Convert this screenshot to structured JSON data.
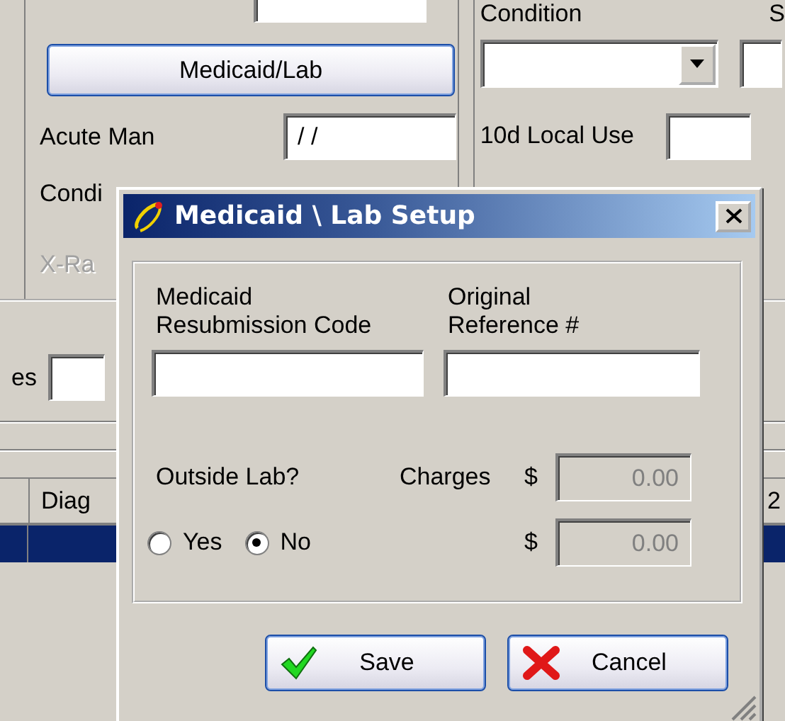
{
  "background_form": {
    "left_panel": {
      "medicaid_lab_button": "Medicaid/Lab",
      "acute_man": {
        "label": "Acute Man",
        "value": "/ /"
      },
      "condition_label": "Condi",
      "xray_label": {
        "text": "X-Ra",
        "disabled": true
      }
    },
    "right_panel": {
      "condition_label": "Condition",
      "column_2_label": "S",
      "local_use_label": "10d Local Use"
    },
    "field_label": "es",
    "table": {
      "columns": [
        "Diag",
        "2"
      ],
      "rows": [
        {
          "selected": true
        }
      ]
    }
  },
  "dialog": {
    "title": "Medicaid \\ Lab Setup",
    "fields": [
      {
        "label": "Medicaid\nResubmission Code"
      },
      {
        "label": "Original\nReference #"
      }
    ],
    "outside_lab": {
      "label": "Outside Lab?",
      "options": [
        {
          "label": "Yes",
          "selected": false
        },
        {
          "label": "No",
          "selected": true
        }
      ]
    },
    "charges": {
      "label": "Charges",
      "amounts": [
        {
          "currency": "$",
          "value": "0.00",
          "disabled": true
        },
        {
          "currency": "$",
          "value": "0.00",
          "disabled": true
        }
      ]
    },
    "buttons": [
      {
        "label": "Save",
        "kind": "save"
      },
      {
        "label": "Cancel",
        "kind": "cancel"
      }
    ]
  }
}
